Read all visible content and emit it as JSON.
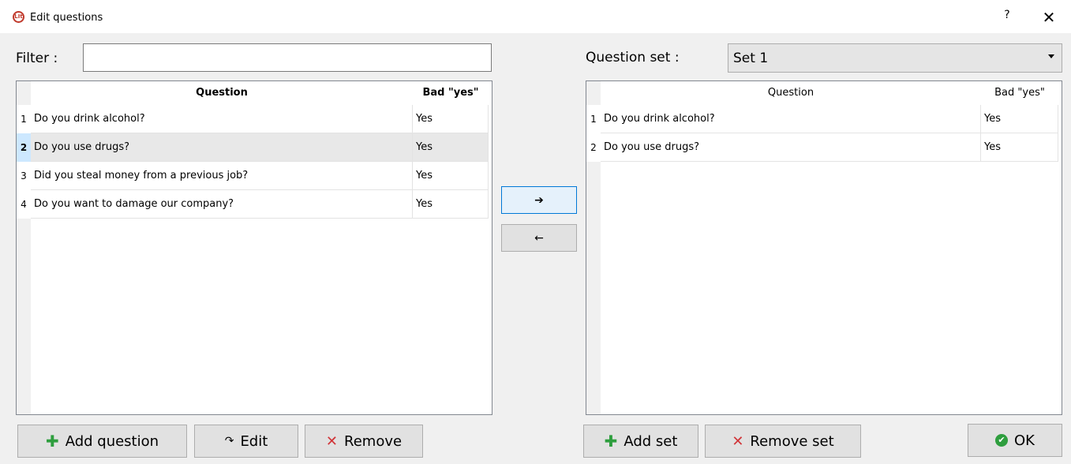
{
  "window": {
    "title": "Edit questions",
    "logo_text": "LIt",
    "help": "?",
    "close": "✕"
  },
  "filter": {
    "label": "Filter :",
    "value": ""
  },
  "question_set": {
    "label": "Question set :",
    "selected": "Set 1"
  },
  "left_table": {
    "headers": [
      "Question",
      "Bad \"yes\""
    ],
    "rows": [
      {
        "n": "1",
        "question": "Do you drink alcohol?",
        "bad_yes": "Yes"
      },
      {
        "n": "2",
        "question": "Do you use drugs?",
        "bad_yes": "Yes"
      },
      {
        "n": "3",
        "question": "Did you steal money from a previous job?",
        "bad_yes": "Yes"
      },
      {
        "n": "4",
        "question": "Do you want to damage our company?",
        "bad_yes": "Yes"
      }
    ]
  },
  "right_table": {
    "headers": [
      "Question",
      "Bad \"yes\""
    ],
    "rows": [
      {
        "n": "1",
        "question": "Do you drink alcohol?",
        "bad_yes": "Yes"
      },
      {
        "n": "2",
        "question": "Do you use drugs?",
        "bad_yes": "Yes"
      }
    ]
  },
  "transfer": {
    "add": "➔",
    "remove": "🡐"
  },
  "buttons": {
    "add_question": "Add question",
    "edit": "Edit",
    "remove": "Remove",
    "add_set": "Add set",
    "remove_set": "Remove set",
    "ok": "OK"
  },
  "icons": {
    "plus": "✚",
    "cross": "✕",
    "edit": "↷",
    "check": "✔"
  }
}
